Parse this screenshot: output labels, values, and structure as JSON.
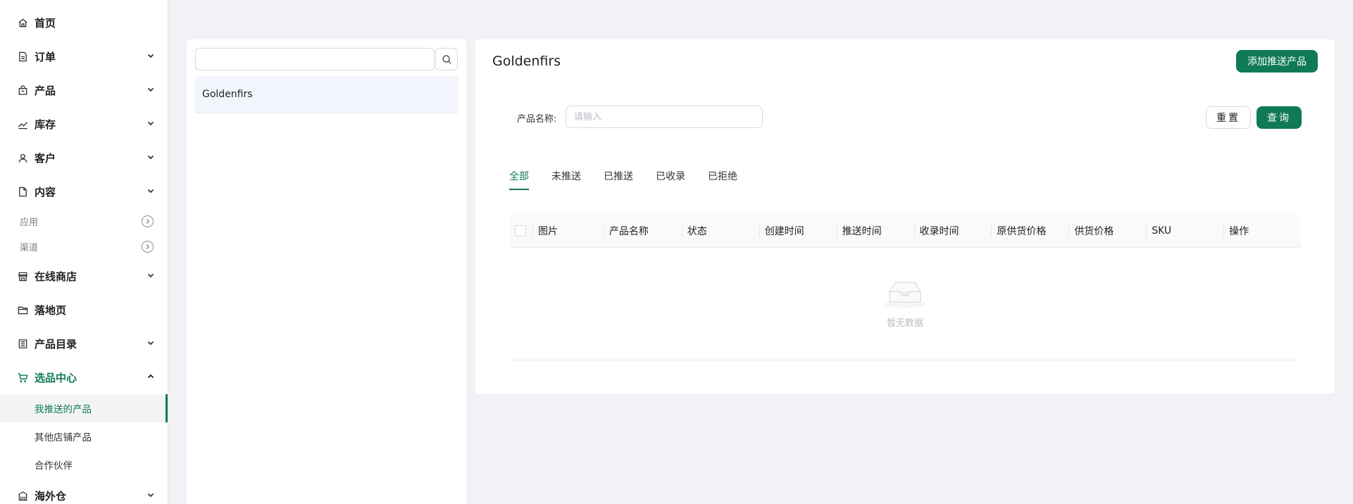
{
  "sidebar": {
    "items": [
      {
        "label": "首页",
        "icon": "home-icon",
        "has_chevron": false
      },
      {
        "label": "订单",
        "icon": "order-icon",
        "has_chevron": true
      },
      {
        "label": "产品",
        "icon": "product-icon",
        "has_chevron": true
      },
      {
        "label": "库存",
        "icon": "inventory-icon",
        "has_chevron": true
      },
      {
        "label": "客户",
        "icon": "customer-icon",
        "has_chevron": true
      },
      {
        "label": "内容",
        "icon": "content-icon",
        "has_chevron": true
      }
    ],
    "groups": [
      {
        "label": "应用"
      },
      {
        "label": "渠道"
      }
    ],
    "items_lower": [
      {
        "label": "在线商店",
        "icon": "store-icon",
        "has_chevron": true
      },
      {
        "label": "落地页",
        "icon": "folder-icon",
        "has_chevron": false
      },
      {
        "label": "产品目录",
        "icon": "catalog-icon",
        "has_chevron": true
      },
      {
        "label": "选品中心",
        "icon": "cart-icon",
        "has_chevron": true,
        "expanded": true
      }
    ],
    "sub_items": [
      {
        "label": "我推送的产品",
        "selected": true
      },
      {
        "label": "其他店铺产品",
        "selected": false
      },
      {
        "label": "合作伙伴",
        "selected": false
      }
    ],
    "last_item": {
      "label": "海外仓",
      "icon": "warehouse-icon",
      "has_chevron": true
    }
  },
  "list_panel": {
    "search_value": "",
    "items": [
      "Goldenfirs"
    ]
  },
  "main": {
    "title": "Goldenfirs",
    "add_button": "添加推送产品",
    "filter_label": "产品名称:",
    "filter_placeholder": "请输入",
    "reset_button": "重置",
    "query_button": "查询",
    "tabs": [
      "全部",
      "未推送",
      "已推送",
      "已收录",
      "已拒绝"
    ],
    "active_tab": "全部",
    "columns": [
      "图片",
      "产品名称",
      "状态",
      "创建时间",
      "推送时间",
      "收录时间",
      "原供货价格",
      "供货价格",
      "SKU",
      "操作"
    ],
    "empty_text": "暂无数据"
  },
  "colors": {
    "brand": "#0f7a55",
    "background": "#f0f2f5",
    "selected_row": "#f2f5fb"
  }
}
